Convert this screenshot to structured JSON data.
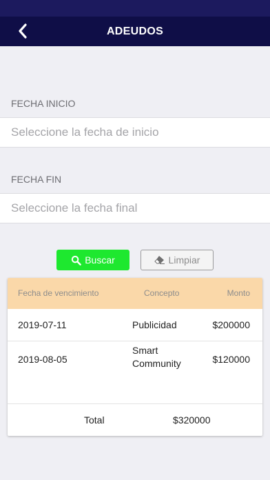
{
  "colors": {
    "nav_bg": "#0f0e47",
    "search_button": "#1ee82f",
    "table_header": "#fad8a9"
  },
  "nav": {
    "back_icon": "chevron-left-icon",
    "title": "ADEUDOS"
  },
  "filters": {
    "start_label": "FECHA INICIO",
    "start_placeholder": "Seleccione la fecha de inicio",
    "end_label": "FECHA FIN",
    "end_placeholder": "Seleccione la fecha final"
  },
  "actions": {
    "search_icon": "search-icon",
    "search_label": "Buscar",
    "clear_icon": "eraser-icon",
    "clear_label": "Limpiar"
  },
  "table": {
    "headers": {
      "due_date": "Fecha de vencimiento",
      "concept": "Concepto",
      "amount": "Monto"
    },
    "rows": [
      {
        "due_date": "2019-07-11",
        "concept_line1": "Publicidad",
        "concept_line2": "",
        "amount": "$200000"
      },
      {
        "due_date": "2019-08-05",
        "concept_line1": "Smart",
        "concept_line2": "Community",
        "amount": "$120000"
      }
    ],
    "total_label": "Total",
    "total_value": "$320000"
  }
}
